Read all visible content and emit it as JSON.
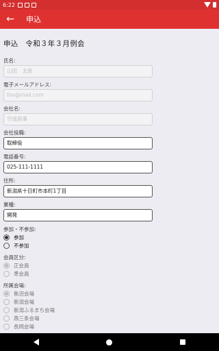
{
  "status_bar": {
    "time": "6:22",
    "icons": [
      "notification-icon",
      "cast-icon",
      "sd-icon",
      "wifi-icon",
      "battery-icon"
    ]
  },
  "app_bar": {
    "back_icon": "arrow-back-icon",
    "title": "申込"
  },
  "page_title": "申込　令和３年３月例会",
  "fields": [
    {
      "label": "氏名:",
      "value": "",
      "placeholder": "山田　太郎",
      "state": "disabled"
    },
    {
      "label": "電子メールアドレス:",
      "value": "",
      "placeholder": "foo@mail.com",
      "state": "disabled"
    },
    {
      "label": "会社名:",
      "value": "",
      "placeholder": "守成商事",
      "state": "disabled"
    },
    {
      "label": "会社役職:",
      "value": "取締役",
      "placeholder": "",
      "state": "enabled"
    },
    {
      "label": "電話番号:",
      "value": "025-111-1111",
      "placeholder": "",
      "state": "enabled"
    },
    {
      "label": "住所:",
      "value": "新潟県十日町市本町1丁目",
      "placeholder": "",
      "state": "enabled"
    },
    {
      "label": "業種:",
      "value": "開発",
      "placeholder": "",
      "state": "enabled"
    }
  ],
  "attendance": {
    "label": "参加・不参加:",
    "options": [
      {
        "label": "参加",
        "checked": true
      },
      {
        "label": "不参加",
        "checked": false
      }
    ]
  },
  "member_type": {
    "label": "会員区分:",
    "disabled": true,
    "options": [
      {
        "label": "正会員",
        "checked": true
      },
      {
        "label": "準会員",
        "checked": false
      }
    ]
  },
  "venue": {
    "label": "所属会場:",
    "disabled": true,
    "options": [
      {
        "label": "魚沼会場",
        "checked": true
      },
      {
        "label": "新潟会場",
        "checked": false
      },
      {
        "label": "新潟ふるまち会場",
        "checked": false
      },
      {
        "label": "燕三条会場",
        "checked": false
      },
      {
        "label": "長岡会場",
        "checked": false
      }
    ]
  },
  "nav_bar": {
    "icons": [
      "nav-back-icon",
      "nav-home-icon",
      "nav-recents-icon"
    ]
  },
  "colors": {
    "app_bar": "#e03131",
    "status_bar": "#d32f2f",
    "background": "#ececf2"
  }
}
